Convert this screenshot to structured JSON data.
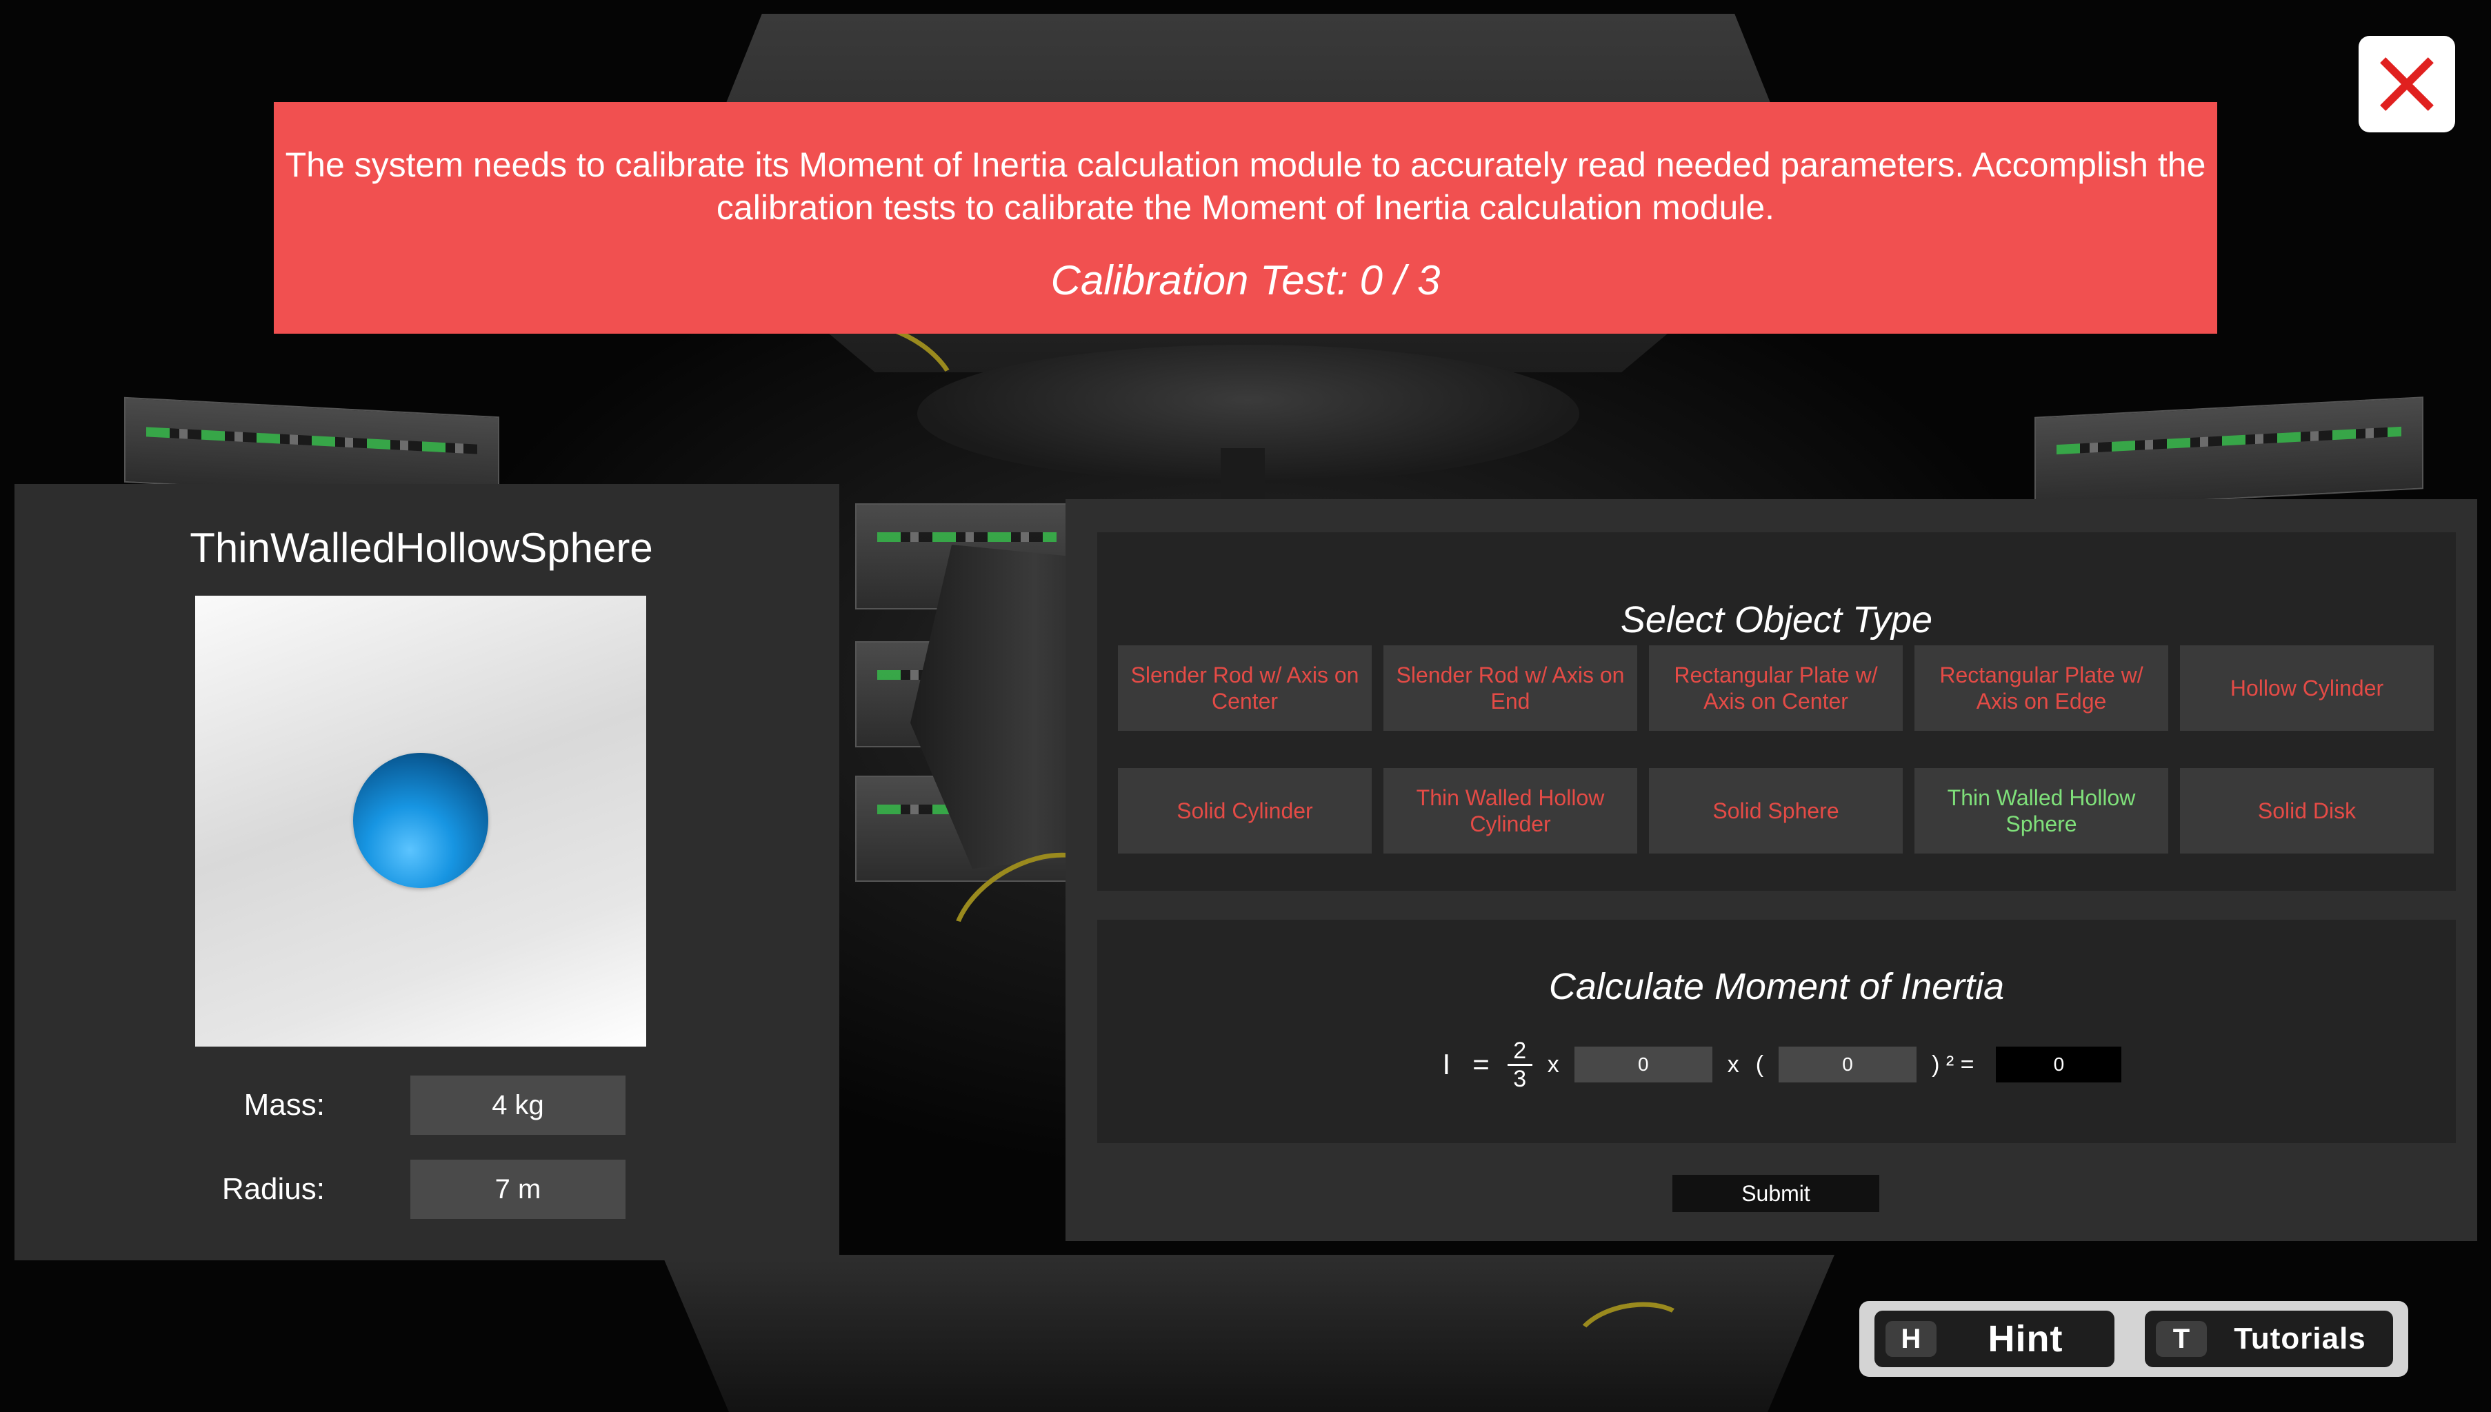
{
  "banner": {
    "message": "The system needs to calibrate its Moment of Inertia calculation module to accurately read needed parameters. Accomplish the calibration tests to calibrate the Moment of Inertia calculation module.",
    "progress": "Calibration Test: 0 / 3"
  },
  "object_panel": {
    "title": "ThinWalledHollowSphere",
    "mass_label": "Mass:",
    "mass_value": "4 kg",
    "radius_label": "Radius:",
    "radius_value": "7 m"
  },
  "select_section": {
    "title": "Select Object Type",
    "types": [
      "Slender Rod w/ Axis on Center",
      "Slender Rod w/ Axis on End",
      "Rectangular Plate w/ Axis on Center",
      "Rectangular Plate w/ Axis on Edge",
      "Hollow Cylinder",
      "Solid Cylinder",
      "Thin Walled Hollow Cylinder",
      "Solid Sphere",
      "Thin Walled Hollow Sphere",
      "Solid Disk"
    ],
    "selected_type": "Thin Walled Hollow Sphere",
    "colors": {
      "unselected": "#e44b46",
      "selected": "#7fe07a"
    }
  },
  "calc_section": {
    "title": "Calculate Moment of Inertia",
    "symbol": "I",
    "equals": "=",
    "fraction": {
      "numerator": "2",
      "denominator": "3"
    },
    "times": "x",
    "open_paren": "(",
    "close_paren_squared": ") ² =",
    "mass_input": "0",
    "radius_input": "0",
    "result": "0"
  },
  "submit_label": "Submit",
  "hotkeys": {
    "hint": {
      "key": "H",
      "label": "Hint"
    },
    "tutorials": {
      "key": "T",
      "label": "Tutorials"
    }
  },
  "colors": {
    "banner": "#f15050",
    "panel": "#2d2d2d",
    "close_x": "#e0201f"
  },
  "icons": {
    "close": "close-x-icon"
  }
}
